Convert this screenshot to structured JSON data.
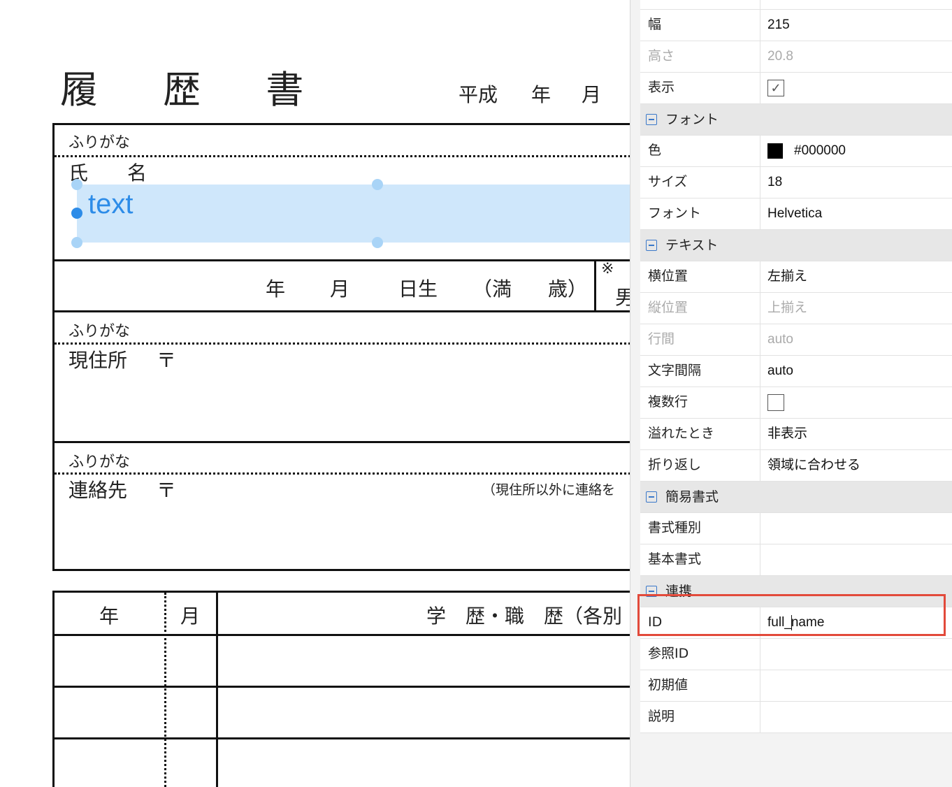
{
  "document": {
    "title": "履 歴 書",
    "date_era": "平成",
    "date_year": "年",
    "date_month": "月",
    "furigana_label": "ふりがな",
    "name_label": "氏　　名",
    "birth_year": "年",
    "birth_month": "月",
    "birth_day": "日生",
    "age_open": "（満",
    "age_close": "歳）",
    "gender_mark": "※",
    "gender_partial": "男",
    "address_label": "現住所",
    "postal_mark": "〒",
    "contact_label": "連絡先",
    "contact_note": "（現住所以外に連絡を",
    "history_year": "年",
    "history_month": "月",
    "history_title": "学　歴・職　歴（各別"
  },
  "selected_field": {
    "text": "text"
  },
  "panel": {
    "rows_top": [
      {
        "key": "幅",
        "value": "215",
        "disabled": false
      },
      {
        "key": "高さ",
        "value": "20.8",
        "disabled": true
      },
      {
        "key": "表示",
        "value": "✓",
        "type": "checkbox",
        "checked": true
      }
    ],
    "font_section": "フォント",
    "font_rows": [
      {
        "key": "色",
        "value": "#000000",
        "swatch": "#000000"
      },
      {
        "key": "サイズ",
        "value": "18"
      },
      {
        "key": "フォント",
        "value": "Helvetica"
      }
    ],
    "text_section": "テキスト",
    "text_rows": [
      {
        "key": "横位置",
        "value": "左揃え",
        "disabled": false
      },
      {
        "key": "縦位置",
        "value": "上揃え",
        "disabled": true
      },
      {
        "key": "行間",
        "value": "auto",
        "disabled": true
      },
      {
        "key": "文字間隔",
        "value": "auto",
        "disabled": false
      },
      {
        "key": "複数行",
        "value": "",
        "type": "checkbox",
        "checked": false
      },
      {
        "key": "溢れたとき",
        "value": "非表示",
        "disabled": false
      },
      {
        "key": "折り返し",
        "value": "領域に合わせる",
        "disabled": false
      }
    ],
    "simple_section": "簡易書式",
    "simple_rows": [
      {
        "key": "書式種別",
        "value": ""
      },
      {
        "key": "基本書式",
        "value": ""
      }
    ],
    "link_section": "連携",
    "id_row": {
      "key": "ID",
      "value_before_caret": "full_",
      "value_after_caret": "name"
    },
    "link_rows": [
      {
        "key": "参照ID",
        "value": ""
      },
      {
        "key": "初期値",
        "value": ""
      },
      {
        "key": "説明",
        "value": ""
      }
    ]
  },
  "colors": {
    "selection_fill": "#cfe7fb",
    "selection_text": "#2d8ce8",
    "highlight_border": "#e24a3b",
    "section_icon": "#3a78c9"
  }
}
